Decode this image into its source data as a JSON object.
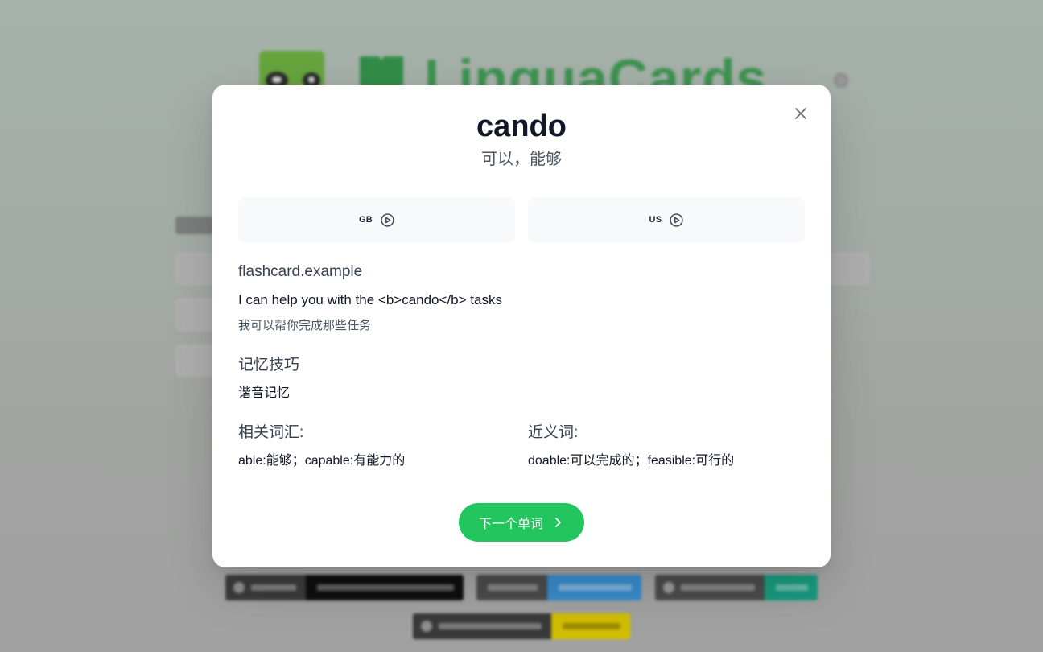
{
  "background": {
    "logo_text": "LinguaCards"
  },
  "modal": {
    "word": "cando",
    "translation": "可以，能够",
    "pronunciations": [
      {
        "label": "GB",
        "icon": "play-circle-icon"
      },
      {
        "label": "US",
        "icon": "play-circle-icon"
      }
    ],
    "example": {
      "heading": "flashcard.example",
      "sentence": "I can help you with the <b>cando</b> tasks",
      "translation": "我可以帮你完成那些任务"
    },
    "mnemonic": {
      "heading": "记忆技巧",
      "text": "谐音记忆"
    },
    "related": {
      "heading": "相关词汇:",
      "text": "able:能够；capable:有能力的"
    },
    "synonyms": {
      "heading": "近义词:",
      "text": "doable:可以完成的；feasible:可行的"
    },
    "next_button": {
      "label": "下一个单词",
      "icon": "chevron-right-icon"
    },
    "close_icon": "close-icon"
  },
  "colors": {
    "accent": "#22c55e",
    "card_bg": "#f8f9fa",
    "title": "#111827",
    "heading": "#374151",
    "muted": "#4b5563"
  }
}
